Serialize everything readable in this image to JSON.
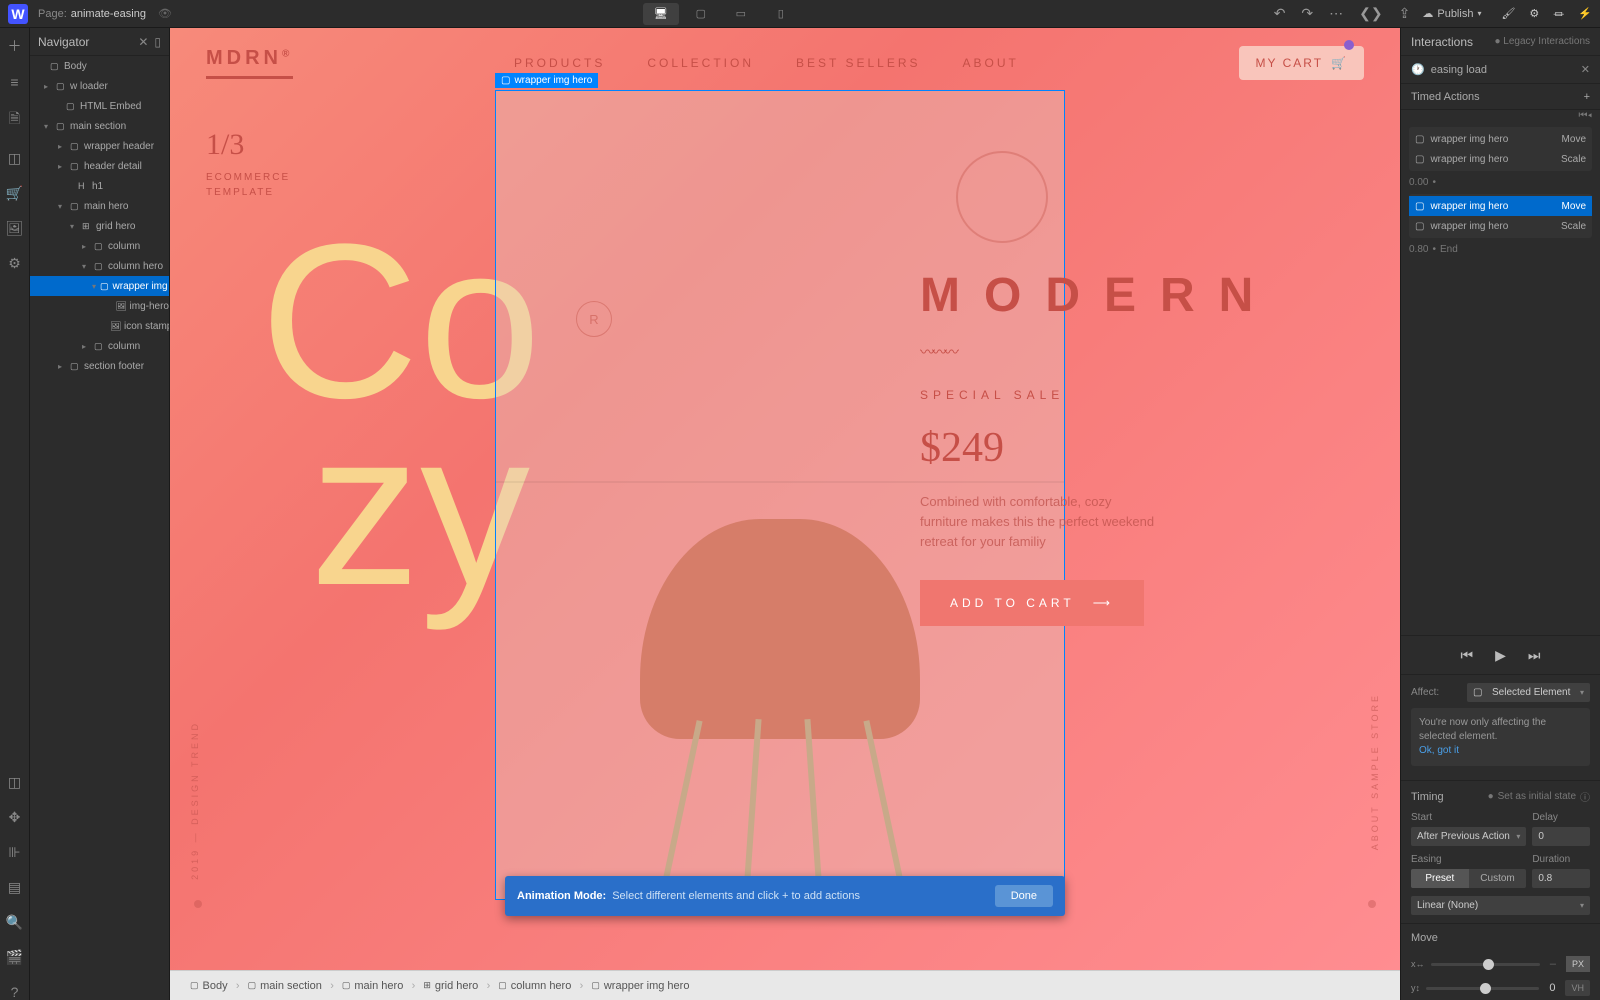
{
  "app": {
    "page_label": "Page:",
    "page_name": "animate-easing",
    "publish": "Publish"
  },
  "navigator": {
    "title": "Navigator",
    "items": [
      {
        "label": "Body",
        "pad": 8
      },
      {
        "label": "w loader",
        "pad": 14,
        "caret": true
      },
      {
        "label": "HTML Embed",
        "pad": 24
      },
      {
        "label": "main section",
        "pad": 14,
        "caret": true,
        "open": true
      },
      {
        "label": "wrapper header",
        "pad": 28,
        "caret": true
      },
      {
        "label": "header detail",
        "pad": 28,
        "caret": true
      },
      {
        "label": "h1",
        "pad": 36,
        "h": true
      },
      {
        "label": "main hero",
        "pad": 28,
        "caret": true,
        "open": true
      },
      {
        "label": "grid hero",
        "pad": 40,
        "caret": true,
        "open": true,
        "grid": true
      },
      {
        "label": "column",
        "pad": 52,
        "caret": true
      },
      {
        "label": "column hero",
        "pad": 52,
        "caret": true,
        "open": true
      },
      {
        "label": "wrapper img hero",
        "pad": 62,
        "caret": true,
        "open": true,
        "selected": true
      },
      {
        "label": "img-hero",
        "pad": 76,
        "img": true
      },
      {
        "label": "icon stamp",
        "pad": 76,
        "img": true
      },
      {
        "label": "column",
        "pad": 52,
        "caret": true
      },
      {
        "label": "section footer",
        "pad": 28,
        "caret": true
      }
    ]
  },
  "hero": {
    "brand": "MDRN",
    "nav": [
      "PRODUCTS",
      "COLLECTION",
      "BEST SELLERS",
      "ABOUT"
    ],
    "mycart": "MY CART",
    "counter": "1/3",
    "sub1": "ECOMMERCE",
    "sub2": "TEMPLATE",
    "cozy1": "Co",
    "cozy2": "zy",
    "modern": "MODERN",
    "special": "SPECIAL SALE",
    "price": "$249",
    "desc": "Combined with comfortable, cozy furniture makes this the perfect weekend retreat for your familiy",
    "add": "ADD TO CART",
    "vert_left": "2019 — DESIGN TREND",
    "vert_right": "ABOUT SAMPLE STORE",
    "selection_label": "wrapper img hero",
    "stamp_r": "R"
  },
  "anim_bar": {
    "mode": "Animation Mode:",
    "text": "Select different elements and click + to add actions",
    "done": "Done"
  },
  "breadcrumb": [
    "Body",
    "main section",
    "main hero",
    "grid hero",
    "column hero",
    "wrapper img hero"
  ],
  "right": {
    "title": "Interactions",
    "legacy": "Legacy Interactions",
    "interaction_name": "easing load",
    "timed_actions": "Timed Actions",
    "groups": [
      {
        "time": "",
        "items": [
          {
            "name": "wrapper img hero",
            "action": "Move"
          },
          {
            "name": "wrapper img hero",
            "action": "Scale"
          }
        ]
      },
      {
        "time": "0.00",
        "items": [
          {
            "name": "wrapper img hero",
            "action": "Move",
            "active": true
          },
          {
            "name": "wrapper img hero",
            "action": "Scale"
          }
        ]
      }
    ],
    "end_time": "0.80",
    "end": "End",
    "affect": "Affect:",
    "affect_val": "Selected Element",
    "note": "You're now only affecting the selected element.",
    "note_link": "Ok, got it",
    "timing": "Timing",
    "set_initial": "Set as initial state",
    "start": "Start",
    "start_val": "After Previous Action",
    "delay": "Delay",
    "delay_val": "0",
    "easing": "Easing",
    "duration": "Duration",
    "duration_val": "0.8",
    "preset": "Preset",
    "custom": "Custom",
    "easing_val": "Linear (None)",
    "move": "Move",
    "move_x_val": "0",
    "move_y_val": "0",
    "unit_px": "PX",
    "unit_vh": "VH"
  }
}
